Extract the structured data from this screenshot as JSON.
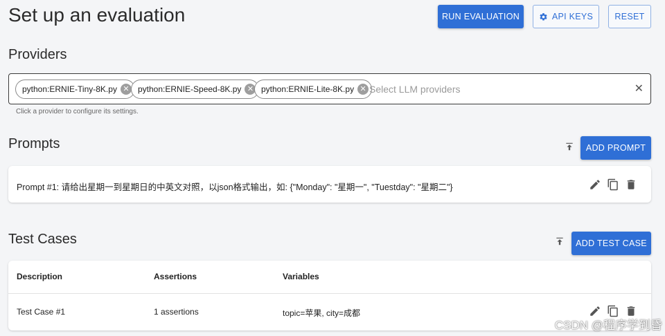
{
  "page": {
    "title": "Set up an evaluation"
  },
  "header_actions": {
    "run_label": "RUN EVALUATION",
    "api_keys_label": "API KEYS",
    "reset_label": "RESET"
  },
  "providers": {
    "title": "Providers",
    "chips": [
      "python:ERNIE-Tiny-8K.py",
      "python:ERNIE-Speed-8K.py",
      "python:ERNIE-Lite-8K.py"
    ],
    "placeholder": "Select LLM providers",
    "helper": "Click a provider to configure its settings."
  },
  "prompts": {
    "title": "Prompts",
    "add_label": "ADD PROMPT",
    "items": [
      {
        "text": "Prompt #1: 请给出星期一到星期日的中英文对照，以json格式输出，如: {\"Monday\": \"星期一\", \"Tuestday\": \"星期二\"}"
      }
    ]
  },
  "test_cases": {
    "title": "Test Cases",
    "add_label": "ADD TEST CASE",
    "columns": [
      "Description",
      "Assertions",
      "Variables"
    ],
    "rows": [
      {
        "description": "Test Case #1",
        "assertions": "1 assertions",
        "variables": "topic=苹果, city=成都"
      }
    ]
  },
  "watermark": "CSDN @程序学到昏",
  "colors": {
    "primary": "#2f6fd6",
    "background": "#f4f5f7",
    "card": "#ffffff"
  },
  "icons": [
    "gear-icon",
    "close-icon",
    "upload-icon",
    "edit-icon",
    "copy-icon",
    "delete-icon"
  ]
}
